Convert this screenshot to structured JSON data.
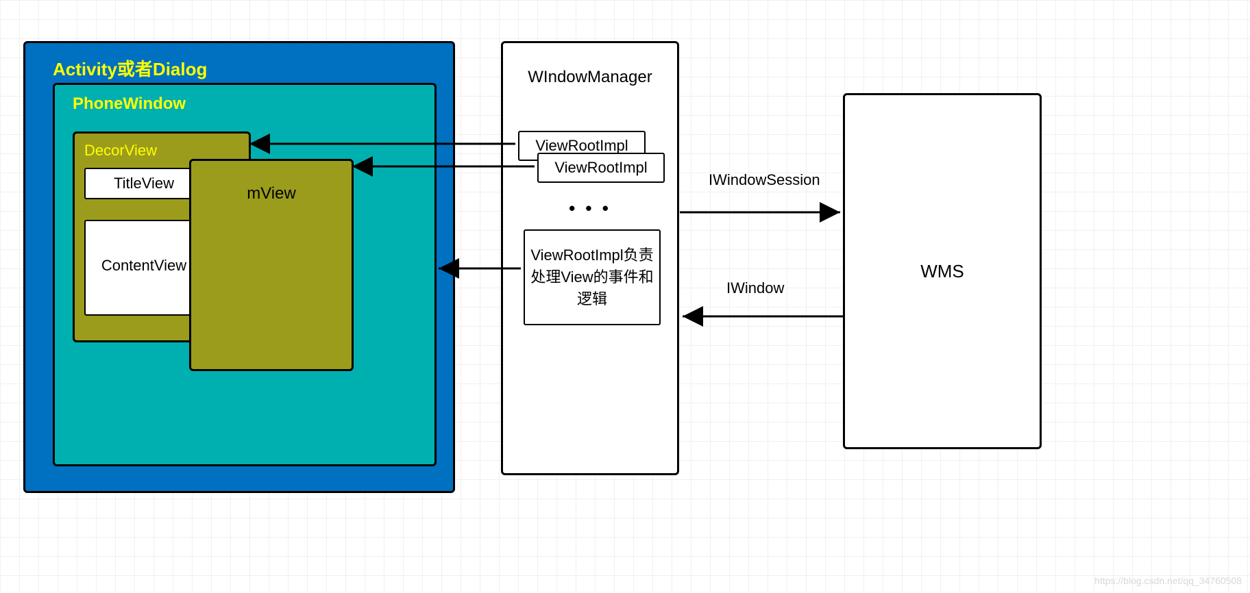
{
  "colors": {
    "blue": "#0070C0",
    "teal": "#00B0B0",
    "olive": "#9C9C1C",
    "yellowText": "#FFFF00"
  },
  "activity": {
    "title": "Activity或者Dialog"
  },
  "phoneWindow": {
    "title": "PhoneWindow"
  },
  "decorView": {
    "title": "DecorView",
    "titleView": "TitleView",
    "contentView": "ContentView"
  },
  "mView": {
    "title": "mView"
  },
  "windowManager": {
    "title": "WIndowManager",
    "viewRoot1": "ViewRootImpl",
    "viewRoot2": "ViewRootImpl",
    "ellipsis": "• • •",
    "desc": "ViewRootImpl负责处理View的事件和逻辑"
  },
  "wms": {
    "title": "WMS"
  },
  "links": {
    "session": "IWindowSession",
    "window": "IWindow"
  },
  "watermark": "https://blog.csdn.net/qq_34760508"
}
